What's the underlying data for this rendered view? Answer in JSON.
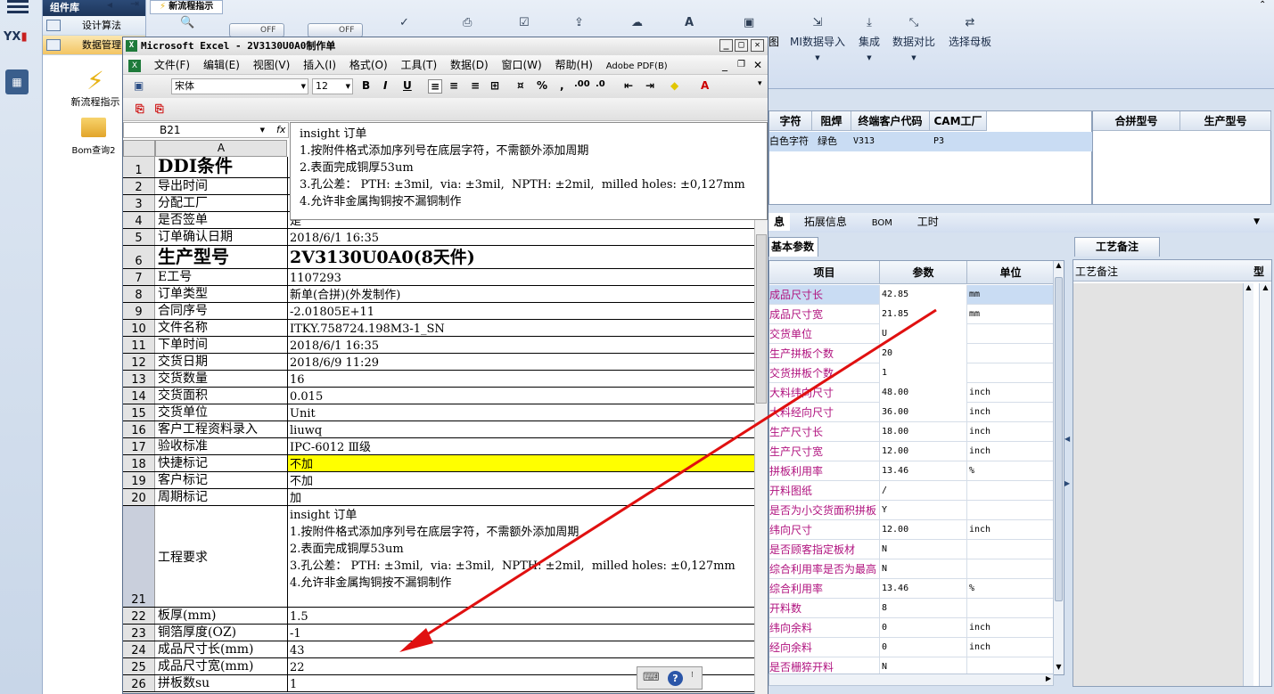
{
  "left_nav": {
    "header": "组件库",
    "items": [
      {
        "label": "设计算法"
      },
      {
        "label": "数据管理"
      }
    ],
    "big_icons": [
      {
        "label": "新流程指示"
      },
      {
        "label": "Bom查询2"
      }
    ]
  },
  "toolbar": {
    "tab": "新流程指示",
    "off1": "OFF",
    "off2": "OFF",
    "buttons": [
      {
        "label": "MI数据导入"
      },
      {
        "label": "集成"
      },
      {
        "label": "数据对比"
      },
      {
        "label": "选择母板"
      }
    ],
    "partial_label": "图"
  },
  "top_grid": {
    "headers": [
      "字符",
      "阻焊",
      "终端客户代码",
      "CAM工厂"
    ],
    "row": [
      "白色字符",
      "绿色",
      "V313",
      "P3"
    ],
    "right_headers": [
      "合拼型号",
      "生产型号"
    ]
  },
  "detail_tabs": [
    "息",
    "拓展信息",
    "BOM",
    "工时"
  ],
  "sub_tab": "基本参数",
  "params": {
    "headers": [
      "项目",
      "参数",
      "单位"
    ],
    "rows": [
      [
        "成品尺寸长",
        "42.85",
        "mm"
      ],
      [
        "成品尺寸宽",
        "21.85",
        "mm"
      ],
      [
        "交货单位",
        "U",
        ""
      ],
      [
        "生产拼板个数",
        "20",
        ""
      ],
      [
        "交货拼板个数",
        "1",
        ""
      ],
      [
        "大料纬向尺寸",
        "48.00",
        "inch"
      ],
      [
        "大料经向尺寸",
        "36.00",
        "inch"
      ],
      [
        "生产尺寸长",
        "18.00",
        "inch"
      ],
      [
        "生产尺寸宽",
        "12.00",
        "inch"
      ],
      [
        "拼板利用率",
        "13.46",
        "%"
      ],
      [
        "开料图纸",
        "/",
        ""
      ],
      [
        "是否为小交货面积拼板",
        "Y",
        ""
      ],
      [
        "纬向尺寸",
        "12.00",
        "inch"
      ],
      [
        "是否顾客指定板材",
        "N",
        ""
      ],
      [
        "综合利用率是否为最高",
        "N",
        ""
      ],
      [
        "综合利用率",
        "13.46",
        "%"
      ],
      [
        "开料数",
        "8",
        ""
      ],
      [
        "纬向余料",
        "0",
        "inch"
      ],
      [
        "经向余料",
        "0",
        "inch"
      ],
      [
        "是否栅猝开料",
        "N",
        ""
      ]
    ]
  },
  "craft": {
    "tab": "工艺备注",
    "header": "工艺备注",
    "extra": "型"
  },
  "excel": {
    "title": "Microsoft Excel - 2V3130U0A0制作单",
    "menu": [
      "文件(F)",
      "编辑(E)",
      "视图(V)",
      "插入(I)",
      "格式(O)",
      "工具(T)",
      "数据(D)",
      "窗口(W)",
      "帮助(H)",
      "Adobe PDF(B)"
    ],
    "font_name": "宋体",
    "font_size": "12",
    "name_box": "B21",
    "fx": "fx",
    "col_a": "A",
    "formula_text": "insight 订单\n1.按附件格式添加序列号在底层字符，不需额外添加周期\n2.表面完成铜厚53um\n3.孔公差： PTH: ±3mil,  via: ±3mil,  NPTH: ±2mil,  milled holes: ±0,127mm\n4.允许非金属掏铜按不漏铜制作",
    "rows": [
      {
        "n": "1",
        "a": "DDI条件",
        "b": ""
      },
      {
        "n": "2",
        "a": "导出时间",
        "b": ""
      },
      {
        "n": "3",
        "a": "分配工厂",
        "b": ""
      },
      {
        "n": "4",
        "a": "是否签单",
        "b": "是"
      },
      {
        "n": "5",
        "a": "订单确认日期",
        "b": "2018/6/1 16:35"
      },
      {
        "n": "6",
        "a": "生产型号",
        "b": "2V3130U0A0(8天件)"
      },
      {
        "n": "7",
        "a": "E工号",
        "b": "1107293"
      },
      {
        "n": "8",
        "a": "订单类型",
        "b": "新单(合拼)(外发制作)"
      },
      {
        "n": "9",
        "a": "合同序号",
        "b": "-2.01805E+11"
      },
      {
        "n": "10",
        "a": "文件名称",
        "b": "ITKY.758724.198M3-1_SN"
      },
      {
        "n": "11",
        "a": "下单时间",
        "b": "2018/6/1 16:35"
      },
      {
        "n": "12",
        "a": "交货日期",
        "b": "2018/6/9 11:29"
      },
      {
        "n": "13",
        "a": "交货数量",
        "b": "16"
      },
      {
        "n": "14",
        "a": "交货面积",
        "b": "0.015"
      },
      {
        "n": "15",
        "a": "交货单位",
        "b": "Unit"
      },
      {
        "n": "16",
        "a": "客户工程资料录入",
        "b": "liuwq"
      },
      {
        "n": "17",
        "a": "验收标准",
        "b": "IPC-6012 Ⅲ级"
      },
      {
        "n": "18",
        "a": "快捷标记",
        "b": "不加"
      },
      {
        "n": "19",
        "a": "客户标记",
        "b": "不加"
      },
      {
        "n": "20",
        "a": "周期标记",
        "b": "加"
      },
      {
        "n": "21",
        "a": "工程要求",
        "b": "insight 订单\n1.按附件格式添加序列号在底层字符，不需额外添加周期\n2.表面完成铜厚53um\n3.孔公差： PTH: ±3mil,  via: ±3mil,  NPTH: ±2mil,  milled holes: ±0,127mm\n4.允许非金属掏铜按不漏铜制作"
      },
      {
        "n": "22",
        "a": "板厚(mm)",
        "b": "1.5"
      },
      {
        "n": "23",
        "a": "铜箔厚度(OZ)",
        "b": "-1"
      },
      {
        "n": "24",
        "a": "成品尺寸长(mm)",
        "b": "43"
      },
      {
        "n": "25",
        "a": "成品尺寸宽(mm)",
        "b": "22"
      },
      {
        "n": "26",
        "a": "拼板数su",
        "b": "1"
      }
    ],
    "highlight_color": "#ffff00"
  },
  "annotation": {
    "arrow_color": "#e01010"
  }
}
